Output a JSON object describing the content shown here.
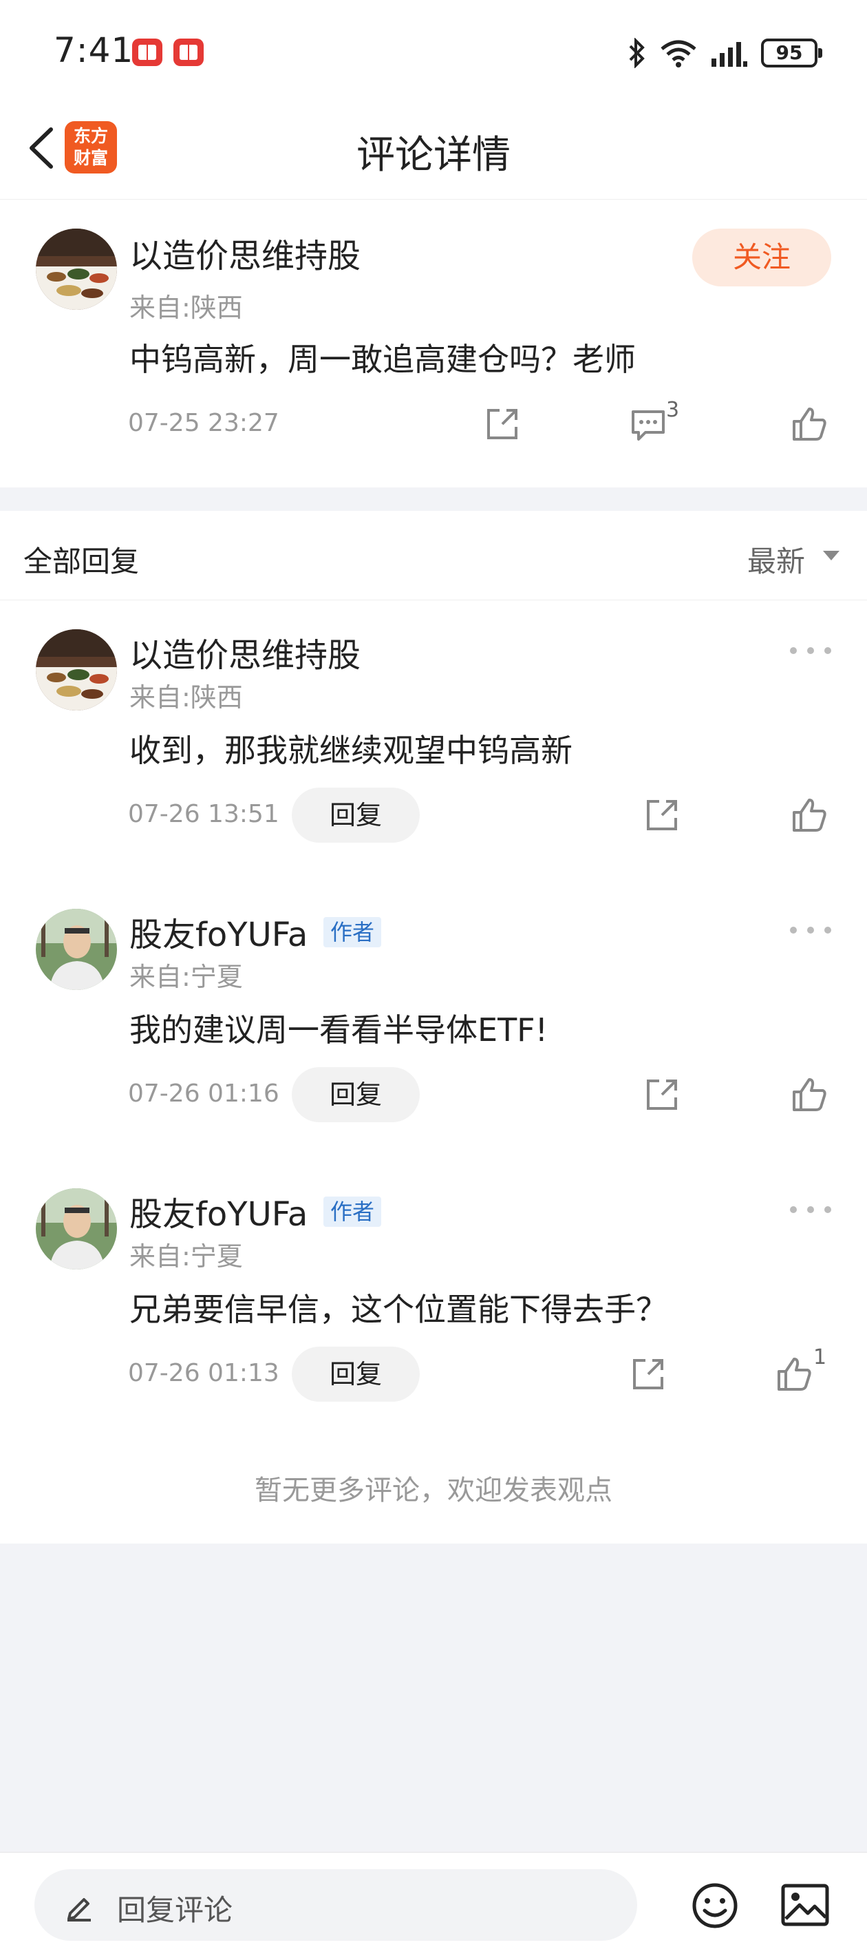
{
  "status_bar": {
    "time": "7:41",
    "battery": "95",
    "icons": [
      "bluetooth-icon",
      "wifi-icon",
      "signal-icon",
      "battery-icon"
    ]
  },
  "nav": {
    "title": "评论详情",
    "logo_line1": "东方",
    "logo_line2": "财富"
  },
  "post": {
    "author": "以造价思维持股",
    "location": "来自:陕西",
    "content": "中钨高新，周一敢追高建仓吗？老师",
    "time": "07-25 23:27",
    "follow_label": "关注",
    "comment_count": "3"
  },
  "replies_section": {
    "title": "全部回复",
    "sort_label": "最新"
  },
  "replies": [
    {
      "author": "以造价思维持股",
      "tag": "",
      "location": "来自:陕西",
      "content": "收到，那我就继续观望中钨高新",
      "time": "07-26 13:51",
      "reply_label": "回复",
      "like_count": ""
    },
    {
      "author": "股友foYUFa",
      "tag": "作者",
      "location": "来自:宁夏",
      "content": "我的建议周一看看半导体ETF!",
      "time": "07-26 01:16",
      "reply_label": "回复",
      "like_count": ""
    },
    {
      "author": "股友foYUFa",
      "tag": "作者",
      "location": "来自:宁夏",
      "content": "兄弟要信早信，这个位置能下得去手？",
      "time": "07-26 01:13",
      "reply_label": "回复",
      "like_count": "1"
    }
  ],
  "footer_note": "暂无更多评论，欢迎发表观点",
  "bottom_bar": {
    "placeholder": "回复评论"
  },
  "colors": {
    "accent": "#f05a22",
    "follow_bg": "#fde9de",
    "author_tag": "#2a6fc4"
  }
}
